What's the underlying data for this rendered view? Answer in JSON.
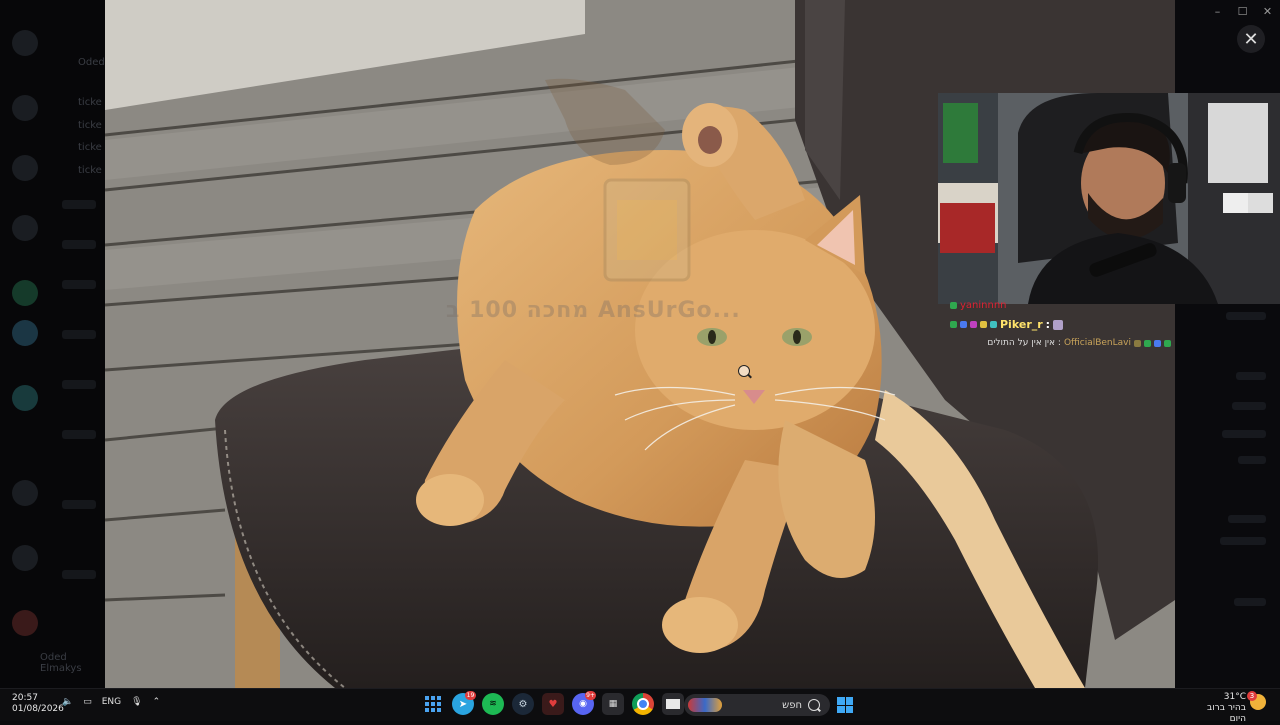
{
  "window": {
    "minimize": "–",
    "maximize": "☐",
    "close": "✕"
  },
  "viewer": {
    "close_label": "✕"
  },
  "watermark": {
    "text": "מחכה 100 ב AnsUrGo..."
  },
  "chat": [
    {
      "user": "yaninnnn",
      "text": ""
    },
    {
      "user": "Piker_r",
      "text": ":"
    },
    {
      "user": "OfficialBenLavi",
      "text": "אין אין על התולים :"
    }
  ],
  "background_app": {
    "channels": [
      "Oded",
      "ticke",
      "ticke",
      "ticke",
      "ticke"
    ],
    "footer_user": "Oded Elmakys"
  },
  "taskbar": {
    "time": "20:57",
    "date": "01/08/2026",
    "language": "ENG",
    "search_placeholder": "חפש",
    "weather_temp": "31°C",
    "weather_desc": "בהיר ברוב היום",
    "notification_count": "3",
    "apps": [
      {
        "name": "start-button",
        "badge": ""
      },
      {
        "name": "telegram",
        "badge": "19"
      },
      {
        "name": "spotify",
        "badge": ""
      },
      {
        "name": "steam",
        "badge": ""
      },
      {
        "name": "app-red",
        "badge": ""
      },
      {
        "name": "discord",
        "badge": "9+"
      },
      {
        "name": "app-dark",
        "badge": ""
      },
      {
        "name": "chrome",
        "badge": ""
      },
      {
        "name": "file-explorer",
        "badge": ""
      }
    ]
  },
  "colors": {
    "accent_blue": "#3fa9f5",
    "chat_name_yellow": "#ffe36b",
    "chat_name_gold": "#c8a35a",
    "badge_red": "#e03c3c"
  }
}
